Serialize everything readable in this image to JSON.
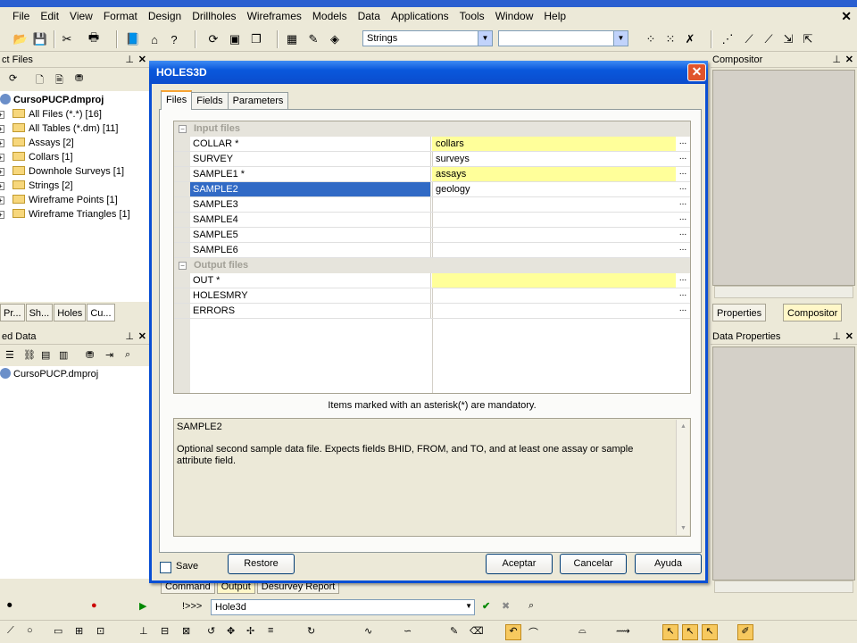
{
  "menubar": {
    "items": [
      "File",
      "Edit",
      "View",
      "Format",
      "Design",
      "Drillholes",
      "Wireframes",
      "Models",
      "Data",
      "Applications",
      "Tools",
      "Window",
      "Help"
    ]
  },
  "toolbar": {
    "strings_combo": "Strings",
    "second_combo": ""
  },
  "project_files": {
    "title": "ct Files",
    "root": "CursoPUCP.dmproj",
    "items": [
      "All Files (*.*) [16]",
      "All Tables (*.dm) [11]",
      "Assays [2]",
      "Collars [1]",
      "Downhole Surveys [1]",
      "Strings [2]",
      "Wireframe Points [1]",
      "Wireframe Triangles [1]"
    ],
    "tabs": [
      "Pr...",
      "Sh...",
      "Holes",
      "Cu..."
    ]
  },
  "loaded_data": {
    "title": "ed Data",
    "root": "CursoPUCP.dmproj"
  },
  "compositor": {
    "title": "Compositor",
    "tabs": [
      "Properties",
      "Compositor"
    ]
  },
  "data_properties": {
    "title": "Data Properties"
  },
  "bottom_tabs": [
    "Command",
    "Output",
    "Desurvey Report"
  ],
  "command_bar": {
    "prompt": "!>>>",
    "value": "Hole3d"
  },
  "dialog": {
    "title": "HOLES3D",
    "tabs": [
      "Files",
      "Fields",
      "Parameters"
    ],
    "active_tab": "Files",
    "input_category": "Input files",
    "output_category": "Output files",
    "input_rows": [
      {
        "name": "COLLAR *",
        "value": "collars",
        "required": true
      },
      {
        "name": "SURVEY",
        "value": "surveys",
        "required": false
      },
      {
        "name": "SAMPLE1 *",
        "value": "assays",
        "required": true
      },
      {
        "name": "SAMPLE2",
        "value": "geology",
        "required": false
      },
      {
        "name": "SAMPLE3",
        "value": "",
        "required": false
      },
      {
        "name": "SAMPLE4",
        "value": "",
        "required": false
      },
      {
        "name": "SAMPLE5",
        "value": "",
        "required": false
      },
      {
        "name": "SAMPLE6",
        "value": "",
        "required": false
      }
    ],
    "output_rows": [
      {
        "name": "OUT *",
        "value": "",
        "required": true
      },
      {
        "name": "HOLESMRY",
        "value": "",
        "required": false
      },
      {
        "name": "ERRORS",
        "value": "",
        "required": false
      }
    ],
    "hint": "Items marked with an asterisk(*) are mandatory.",
    "description_title": "SAMPLE2",
    "description_text": "Optional second sample data file. Expects fields BHID, FROM, and TO, and at least one assay or sample attribute field.",
    "save_label": "Save",
    "restore_label": "Restore",
    "ok_label": "Aceptar",
    "cancel_label": "Cancelar",
    "help_label": "Ayuda"
  },
  "colors": {
    "title_blue": "#0a58dc",
    "required_yellow": "#ffff9a",
    "selection_blue": "#316ac5",
    "tab_accent": "#f7a433"
  }
}
